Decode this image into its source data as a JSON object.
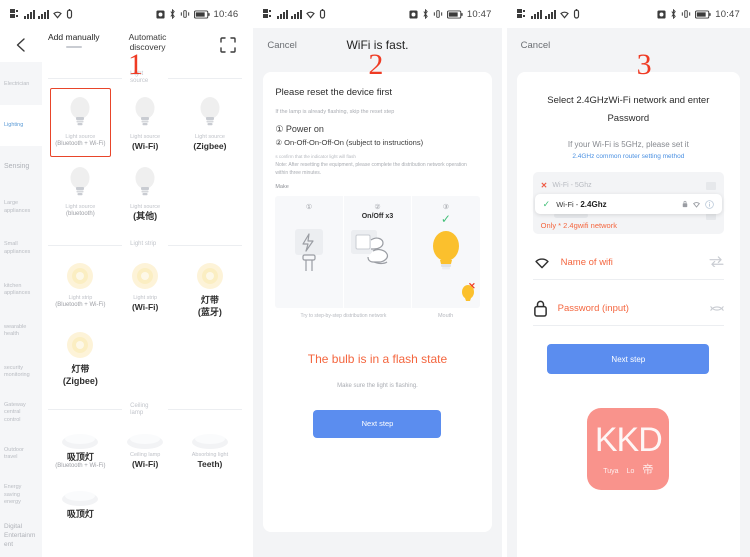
{
  "statusbar": {
    "time_1": "10:46",
    "time_2": "10:47",
    "time_3": "10:47",
    "icons_left": [
      "qr-signal-icon",
      "signal-bars-icon",
      "signal-bars-2-icon",
      "wifi-icon",
      "usb-icon"
    ],
    "icons_right": [
      "alarm-icon",
      "bluetooth-icon",
      "vibrate-icon",
      "battery-icon"
    ]
  },
  "screen1": {
    "step_number": "1",
    "nav": {
      "back_icon": "chevron-left-icon",
      "tab_manual": "Add manually",
      "tab_auto": "Automatic discovery",
      "scan_icon": "scan-frame-icon"
    },
    "categories": [
      {
        "label": "Electrician",
        "active": false
      },
      {
        "label": "Lighting",
        "active": true
      },
      {
        "label": "Sensing",
        "active": false
      },
      {
        "label": "Large appliances",
        "active": false
      },
      {
        "label": "Small appliances",
        "active": false
      },
      {
        "label": "kitchen appliances",
        "active": false
      },
      {
        "label": "wearable health",
        "active": false
      },
      {
        "label": "security monitoring",
        "active": false
      },
      {
        "label": "Gateway central control",
        "active": false
      },
      {
        "label": "Outdoor travel",
        "active": false
      },
      {
        "label": "Energy saving energy",
        "active": false
      },
      {
        "label": "Digital Entertainment",
        "active": false
      }
    ],
    "sections": [
      {
        "title": "Light source",
        "icon": "bulb-icon",
        "items": [
          {
            "label": "Light source",
            "sub": "(Bluetooth + Wi-Fi)",
            "selected": true,
            "cn": false
          },
          {
            "label": "Light source",
            "sub": "(Wi-Fi)",
            "selected": false,
            "cn": false
          },
          {
            "label": "Light source",
            "sub": "(Zigbee)",
            "selected": false,
            "cn": false
          },
          {
            "label": "Light source",
            "sub": "(bluetooth)",
            "selected": false,
            "cn": false
          },
          {
            "label": "Light source",
            "sub": "(其他)",
            "selected": false,
            "cn": true
          }
        ]
      },
      {
        "title": "Light strip",
        "icon": "strip-icon",
        "items": [
          {
            "label": "Light strip",
            "sub": "(Bluetooth + Wi-Fi)",
            "selected": false,
            "cn": false
          },
          {
            "label": "Light strip",
            "sub": "(Wi-Fi)",
            "selected": false,
            "cn": false
          },
          {
            "label": "灯带",
            "sub": "(蓝牙)",
            "selected": false,
            "cn": true
          },
          {
            "label": "灯带",
            "sub": "(Zigbee)",
            "selected": false,
            "cn": true
          }
        ]
      },
      {
        "title": "Ceiling lamp",
        "icon": "ceiling-icon",
        "items": [
          {
            "label": "吸顶灯",
            "sub": "(Bluetooth + Wi-Fi)",
            "selected": false,
            "cn": true
          },
          {
            "label": "Ceiling lamp",
            "sub": "(Wi-Fi)",
            "selected": false,
            "cn": false
          },
          {
            "label": "Absorbing light",
            "sub": "Teeth)",
            "selected": false,
            "cn": false
          },
          {
            "label": "吸顶灯",
            "sub": "",
            "selected": false,
            "cn": true
          }
        ]
      }
    ]
  },
  "screen2": {
    "step_number": "2",
    "cancel": "Cancel",
    "header_title": "WiFi is fast.",
    "title": "Please reset the device first",
    "note": "If the lamp is already flashing, skip the reset step",
    "step_1": "① Power on",
    "step_2": "② On-Off-On-Off-On (subject to instructions)",
    "tiny": "s confirm that the indicator light will flash",
    "tiny2": "Note: After resetting the equipment, please complete the distribution network operation within three minutes.",
    "make": "Make",
    "illus": {
      "p1_num": "①",
      "p1_icon": "power-plug-icon",
      "p2_num": "②",
      "p2_caption": "On/Off x3",
      "p2_icon": "hand-switch-icon",
      "p3_num": "③",
      "p3_check": "✓",
      "p3_icon": "bulb-lit-icon",
      "p3_cross": "✕",
      "caption_left": "Try to step-by-step distribution network",
      "caption_right": "Mouth"
    },
    "flash_title": "The bulb is in a flash state",
    "flash_sub": "Make sure the light is flashing.",
    "next_button": "Next step"
  },
  "screen3": {
    "step_number": "3",
    "cancel": "Cancel",
    "title_line1": "Select 2.4GHzWi-Fi network and enter",
    "title_line2": "Password",
    "subtitle": "If your Wi-Fi is 5GHz, please set it",
    "link": "2.4GHz common router setting method",
    "wifi_list": {
      "ghost_label": "Wi-Fi - 5Ghz",
      "ghost_mark": "✕",
      "selected_check": "✓",
      "selected_prefix": "Wi-Fi - ",
      "selected_band": "2.4Ghz",
      "selected_icons": [
        "lock-icon",
        "wifi-icon",
        "info-icon"
      ],
      "only_note": "Only * 2.4gwifi network"
    },
    "fields": [
      {
        "icon": "wifi-icon",
        "text": "Name of wifi",
        "action": "switch-network-icon"
      },
      {
        "icon": "lock-icon",
        "text": "Password (input)",
        "action": "eye-toggle-icon"
      }
    ],
    "next_button": "Next step",
    "logo": {
      "text": "KKD",
      "sub_left": "Tuya",
      "sub_mid": "Lo",
      "sub_cn": "帝",
      "color": "#f9938c"
    }
  },
  "colors": {
    "accent_red": "#ef3b24",
    "orange": "#f4663f",
    "blue": "#5b8def",
    "link_blue": "#4a90e2",
    "green": "#45c07a",
    "bulb_yellow": "#fbc02d",
    "panel_bg": "#f3f4f6"
  }
}
